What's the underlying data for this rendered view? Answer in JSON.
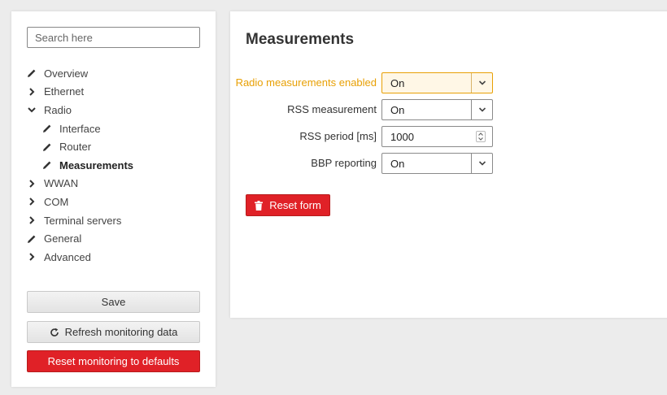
{
  "sidebar": {
    "search_placeholder": "Search here",
    "items": [
      {
        "label": "Overview",
        "icon": "pencil-icon",
        "level": 0
      },
      {
        "label": "Ethernet",
        "icon": "chevron-right-icon",
        "level": 0
      },
      {
        "label": "Radio",
        "icon": "chevron-down-icon",
        "level": 0
      },
      {
        "label": "Interface",
        "icon": "pencil-icon",
        "level": 1
      },
      {
        "label": "Router",
        "icon": "pencil-icon",
        "level": 1
      },
      {
        "label": "Measurements",
        "icon": "pencil-icon",
        "level": 1,
        "active": true
      },
      {
        "label": "WWAN",
        "icon": "chevron-right-icon",
        "level": 0
      },
      {
        "label": "COM",
        "icon": "chevron-right-icon",
        "level": 0
      },
      {
        "label": "Terminal servers",
        "icon": "chevron-right-icon",
        "level": 0
      },
      {
        "label": "General",
        "icon": "pencil-icon",
        "level": 0
      },
      {
        "label": "Advanced",
        "icon": "chevron-right-icon",
        "level": 0
      }
    ],
    "save_label": "Save",
    "refresh_label": "Refresh monitoring data",
    "reset_defaults_label": "Reset monitoring to defaults"
  },
  "main": {
    "title": "Measurements",
    "fields": [
      {
        "label": "Radio measurements enabled",
        "value": "On",
        "type": "select",
        "highlight": true
      },
      {
        "label": "RSS measurement",
        "value": "On",
        "type": "select"
      },
      {
        "label": "RSS period [ms]",
        "value": "1000",
        "type": "number"
      },
      {
        "label": "BBP reporting",
        "value": "On",
        "type": "select"
      }
    ],
    "reset_form_label": "Reset form"
  },
  "colors": {
    "accent_orange": "#e8a005",
    "danger_red": "#e02127",
    "background": "#ececec"
  }
}
